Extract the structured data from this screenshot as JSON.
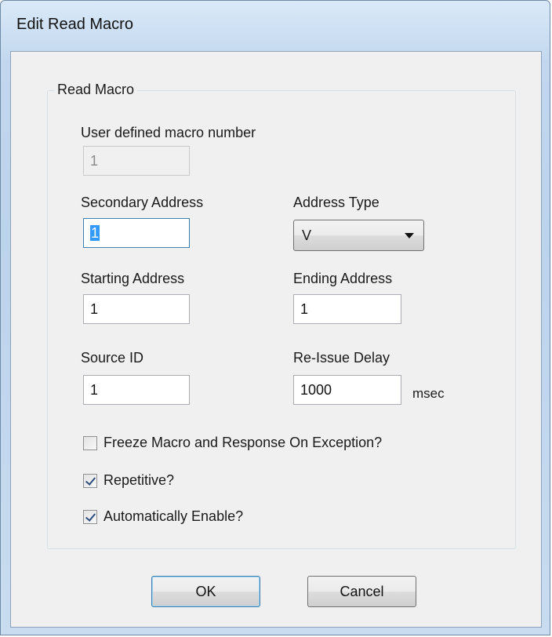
{
  "window": {
    "title": "Edit Read Macro"
  },
  "group": {
    "label": "Read Macro"
  },
  "fields": {
    "macro_number": {
      "label": "User defined macro number",
      "value": "1"
    },
    "secondary_address": {
      "label": "Secondary Address",
      "value": "1"
    },
    "address_type": {
      "label": "Address Type",
      "value": "V"
    },
    "starting_address": {
      "label": "Starting Address",
      "value": "1"
    },
    "ending_address": {
      "label": "Ending Address",
      "value": "1"
    },
    "source_id": {
      "label": "Source ID",
      "value": "1"
    },
    "reissue_delay": {
      "label": "Re-Issue Delay",
      "value": "1000",
      "unit": "msec"
    }
  },
  "checkboxes": {
    "freeze": {
      "label": "Freeze Macro and Response On Exception?",
      "checked": false
    },
    "repetitive": {
      "label": "Repetitive?",
      "checked": true
    },
    "auto_enable": {
      "label": "Automatically Enable?",
      "checked": true
    }
  },
  "buttons": {
    "ok": "OK",
    "cancel": "Cancel"
  }
}
